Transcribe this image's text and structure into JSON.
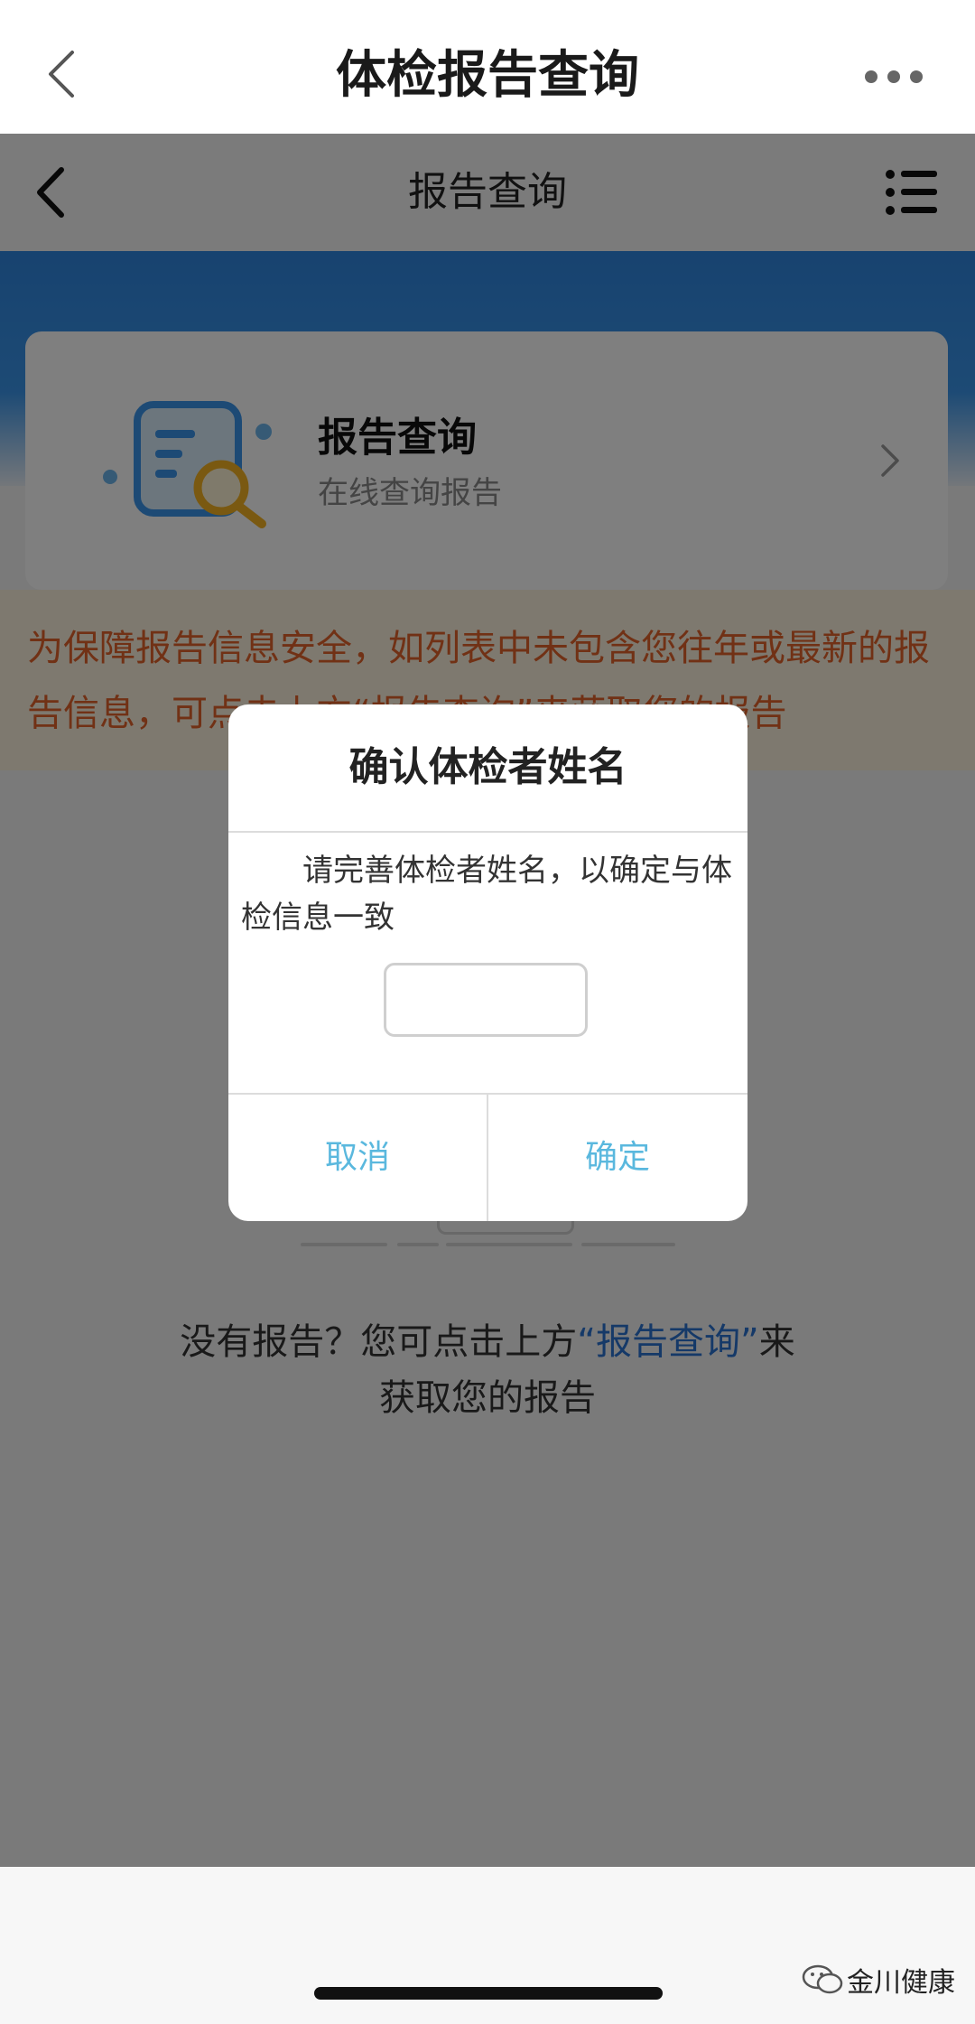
{
  "outer_nav": {
    "title": "体检报告查询"
  },
  "inner_nav": {
    "title": "报告查询"
  },
  "report_card": {
    "title": "报告查询",
    "subtitle": "在线查询报告"
  },
  "notice": {
    "text": "为保障报告信息安全，如列表中未包含您往年或最新的报告信息，可点击上方“报告查询”来获取您的报告"
  },
  "empty_state": {
    "text_before": "没有报告？您可点击上方",
    "link_text": "“报告查询”",
    "text_after": "来获取您的报告"
  },
  "dialog": {
    "title": "确认体检者姓名",
    "message": "请完善体检者姓名，以确定与体检信息一致",
    "input_value": "",
    "cancel_label": "取消",
    "confirm_label": "确定"
  },
  "watermark": {
    "text": "金川健康"
  },
  "colors": {
    "brand_blue": "#2f86e0",
    "notice_text": "#e2622b",
    "dialog_button": "#5ab8de",
    "link": "#2a72d1"
  },
  "icons": [
    "back-chevron-icon",
    "more-dots-icon",
    "menu-list-icon",
    "report-search-icon",
    "chevron-right-icon",
    "wechat-icon"
  ]
}
